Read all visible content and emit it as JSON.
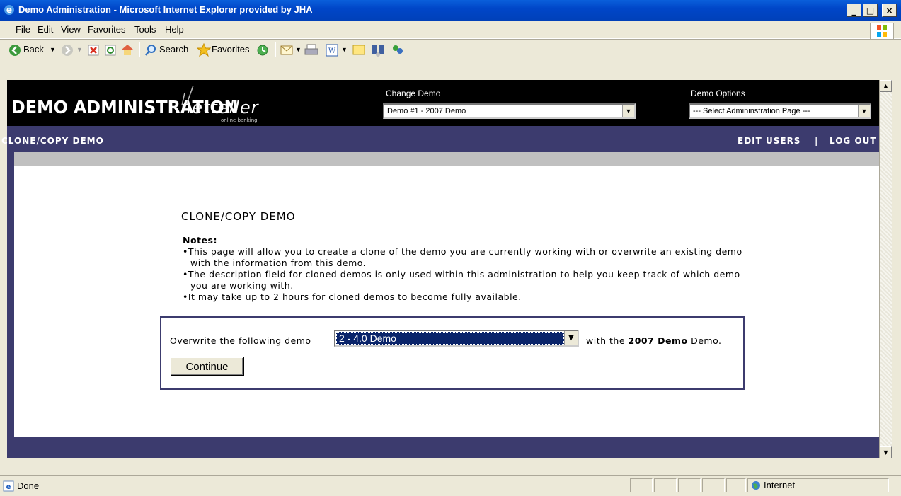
{
  "window": {
    "title": "Demo Administration - Microsoft Internet Explorer provided by JHA",
    "minimize": "_",
    "maximize": "□",
    "close": "×"
  },
  "menu": [
    "File",
    "Edit",
    "View",
    "Favorites",
    "Tools",
    "Help"
  ],
  "toolbar": {
    "back": "Back",
    "search": "Search",
    "favorites": "Favorites"
  },
  "header": {
    "logo_title": "DEMO ADMINISTRATION",
    "brand": "netteller",
    "brand_sub": "online banking",
    "change_demo_label": "Change Demo",
    "change_demo_value": "Demo #1 - 2007 Demo",
    "demo_options_label": "Demo Options",
    "demo_options_value": "--- Select Admininstration Page ---"
  },
  "nav": {
    "left": "CLONE/COPY DEMO",
    "edit_users": "EDIT USERS",
    "separator": "|",
    "logout": "LOG OUT"
  },
  "content": {
    "title": "CLONE/COPY DEMO",
    "notes_label": "Notes:",
    "notes": [
      "This page will allow you to create a clone of the demo you are currently working with or overwrite an existing demo with the information from this demo.",
      "The description field for cloned demos is only used within this administration to help you keep track of which demo you are working with.",
      "It may take up to 2 hours for cloned demos to become fully available."
    ],
    "overwrite_label": "Overwrite the following demo",
    "selected_demo": "2 - 4.0 Demo",
    "with_prefix": "with the",
    "source_demo": "2007 Demo",
    "with_suffix": "Demo.",
    "continue_label": "Continue"
  },
  "status": {
    "text": "Done",
    "zone": "Internet"
  }
}
